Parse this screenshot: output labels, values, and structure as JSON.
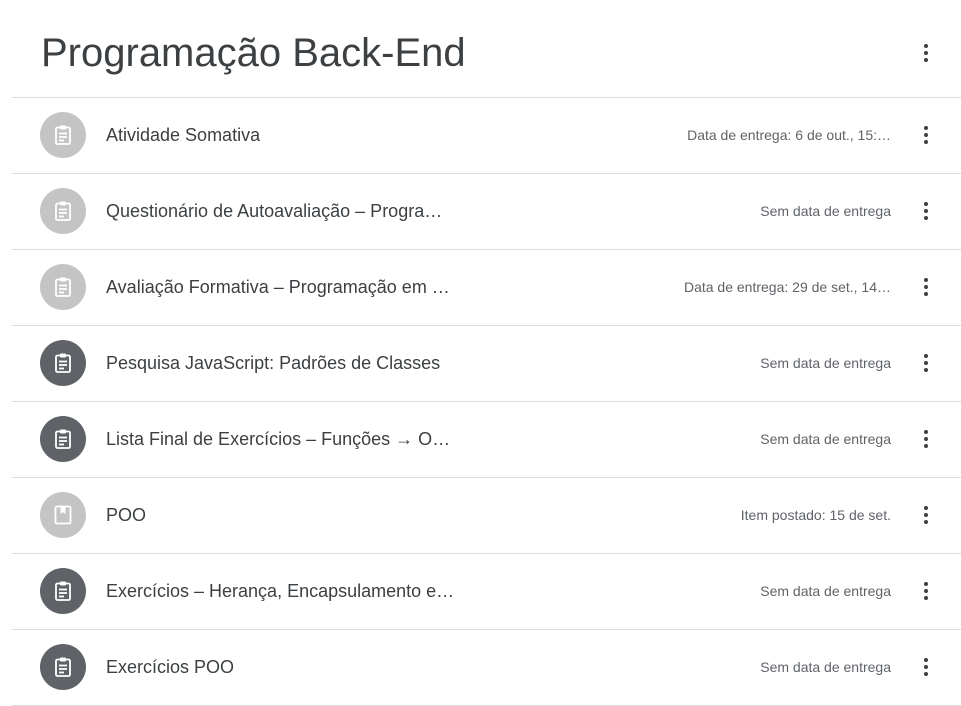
{
  "topic": {
    "title": "Programação Back-End",
    "menu_icon": "more-vert-icon"
  },
  "colors": {
    "icon_inactive_bg": "#c4c4c4",
    "icon_active_bg": "#5f6368",
    "text_primary": "#3c4043",
    "text_secondary": "#5f6368",
    "divider": "#dadce0"
  },
  "items": [
    {
      "title": "Atividade Somativa",
      "meta": "Data de entrega: 6 de out., 15:…",
      "icon": "assignment-icon",
      "state": "inactive"
    },
    {
      "title": "Questionário de Autoavaliação – Progra…",
      "meta": "Sem data de entrega",
      "icon": "assignment-icon",
      "state": "inactive"
    },
    {
      "title": "Avaliação Formativa – Programação em …",
      "meta": "Data de entrega: 29 de set., 14…",
      "icon": "assignment-icon",
      "state": "inactive"
    },
    {
      "title": "Pesquisa JavaScript: Padrões de Classes",
      "meta": "Sem data de entrega",
      "icon": "assignment-icon",
      "state": "active"
    },
    {
      "title": "Lista Final de Exercícios – Funções → O…",
      "meta": "Sem data de entrega",
      "icon": "assignment-icon",
      "state": "active"
    },
    {
      "title": "POO",
      "meta": "Item postado: 15 de set.",
      "icon": "material-icon",
      "state": "inactive"
    },
    {
      "title": "Exercícios – Herança, Encapsulamento e…",
      "meta": "Sem data de entrega",
      "icon": "assignment-icon",
      "state": "active"
    },
    {
      "title": "Exercícios POO",
      "meta": "Sem data de entrega",
      "icon": "assignment-icon",
      "state": "active"
    }
  ]
}
